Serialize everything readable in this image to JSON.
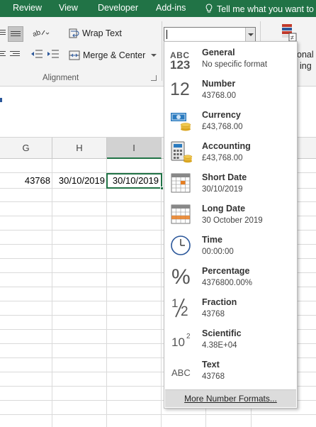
{
  "tabs": [
    "Review",
    "View",
    "Developer",
    "Add-ins"
  ],
  "tell_me": "Tell me what you want to",
  "ribbon": {
    "wrap_text": "Wrap Text",
    "merge_center": "Merge & Center",
    "group_label": "Alignment",
    "cond_fmt_partial_1": "onal",
    "cond_fmt_partial_2": "ing"
  },
  "grid": {
    "columns": [
      "G",
      "H",
      "I"
    ],
    "selected_column": "I",
    "cells": {
      "G": "43768",
      "H": "30/10/2019",
      "I": "30/10/2019"
    }
  },
  "number_formats": [
    {
      "name": "General",
      "sample": "No specific format",
      "icon": "general-abc123-icon"
    },
    {
      "name": "Number",
      "sample": "43768.00",
      "icon": "number-12-icon"
    },
    {
      "name": "Currency",
      "sample": "£43,768.00",
      "icon": "currency-money-icon"
    },
    {
      "name": "Accounting",
      "sample": " £43,768.00",
      "icon": "accounting-calculator-icon"
    },
    {
      "name": "Short Date",
      "sample": "30/10/2019",
      "icon": "short-date-calendar-icon"
    },
    {
      "name": "Long Date",
      "sample": "30 October 2019",
      "icon": "long-date-calendar-icon"
    },
    {
      "name": "Time",
      "sample": "00:00:00",
      "icon": "clock-icon"
    },
    {
      "name": "Percentage",
      "sample": "4376800.00%",
      "icon": "percent-icon"
    },
    {
      "name": "Fraction",
      "sample": "43768",
      "icon": "fraction-half-icon"
    },
    {
      "name": "Scientific",
      "sample": "4.38E+04",
      "icon": "scientific-10-squared-icon"
    },
    {
      "name": "Text",
      "sample": "43768",
      "icon": "text-abc-icon"
    }
  ],
  "more_formats": "More Number Formats...",
  "icon_glyphs": {
    "general_top": "ABC",
    "general_bottom": "123",
    "number": "12",
    "percent": "%",
    "fraction_one": "1",
    "fraction_two": "2",
    "sci_base": "10",
    "sci_exp": "2",
    "text": "ABC"
  },
  "colors": {
    "excel_green": "#217346",
    "accent_blue": "#2b579a"
  }
}
